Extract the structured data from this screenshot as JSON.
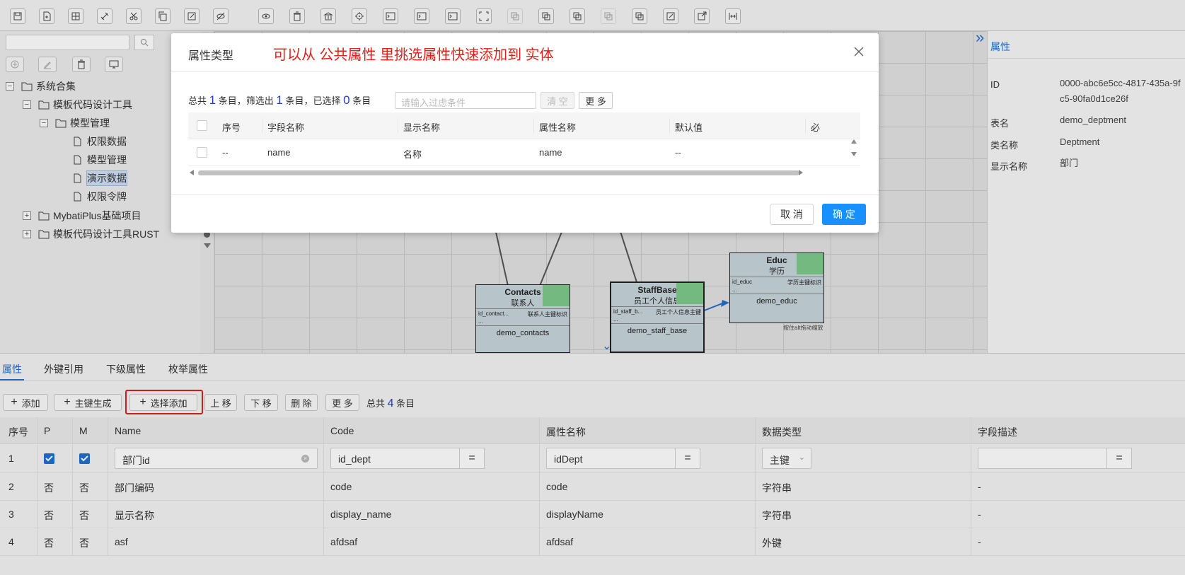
{
  "toolbar": {
    "icons": [
      "save-icon",
      "new-file-icon",
      "grid-icon",
      "link-icon",
      "scissors-icon",
      "copy-icon",
      "edit-icon",
      "hide-icon",
      "eye-icon",
      "trash-icon",
      "bank-icon",
      "target-icon",
      "terminal-icon",
      "terminal-icon",
      "terminal-icon",
      "select-icon",
      "group-icon",
      "group-icon",
      "group-icon",
      "group-icon",
      "group-icon",
      "edit-icon",
      "export-icon",
      "distribute-icon"
    ]
  },
  "tree": {
    "root": "系统合集",
    "items": [
      {
        "label": "模板代码设计工具",
        "level": 1,
        "expanded": true
      },
      {
        "label": "模型管理",
        "level": 2,
        "expanded": true
      },
      {
        "label": "权限数据",
        "level": 3,
        "file": true
      },
      {
        "label": "模型管理",
        "level": 3,
        "file": true
      },
      {
        "label": "演示数据",
        "level": 3,
        "file": true,
        "selected": true
      },
      {
        "label": "权限令牌",
        "level": 3,
        "file": true
      },
      {
        "label": "MybatiPlus基础项目",
        "level": 1,
        "expanded": false
      },
      {
        "label": "模板代码设计工具RUST",
        "level": 1,
        "expanded": false
      }
    ]
  },
  "canvas": {
    "entities": [
      {
        "title": "Contacts",
        "sub": "联系人",
        "attr_left": "id_contact...",
        "attr_right": "联系人主键标识",
        "dots": "...",
        "table": "demo_contacts"
      },
      {
        "title": "StaffBase",
        "sub": "员工个人信息",
        "attr_left": "id_staff_b...",
        "attr_right": "员工个人信息主键",
        "dots": "...",
        "table": "demo_staff_base"
      },
      {
        "title": "Educ",
        "sub": "学历",
        "attr_left": "id_educ",
        "attr_right": "学历主键标识",
        "dots": "...",
        "table": "demo_educ"
      }
    ],
    "hint": "按住alt拖动缩放"
  },
  "right_panel": {
    "title": "属性",
    "rows": [
      {
        "label": "ID",
        "value": "0000-abc6e5cc-4817-435a-9fc5-90fa0d1ce26f"
      },
      {
        "label": "表名",
        "value": "demo_deptment"
      },
      {
        "label": "类名称",
        "value": "Deptment"
      },
      {
        "label": "显示名称",
        "value": "部门"
      }
    ]
  },
  "bottom": {
    "tabs": [
      "属性",
      "外键引用",
      "下级属性",
      "枚举属性"
    ],
    "actions": {
      "add": "添加",
      "pk_gen": "主键生成",
      "select_add": "选择添加",
      "up": "上 移",
      "down": "下 移",
      "delete": "删 除",
      "more": "更 多"
    },
    "count": {
      "prefix": "总共",
      "num": "4",
      "suffix": "条目"
    },
    "headers": [
      "序号",
      "P",
      "M",
      "Name",
      "Code",
      "属性名称",
      "数据类型",
      "字段描述"
    ],
    "rows": [
      {
        "idx": "1",
        "p": "",
        "m": "",
        "name": "部门id",
        "code": "id_dept",
        "prop": "idDept",
        "type": "主键",
        "desc": ""
      },
      {
        "idx": "2",
        "p": "否",
        "m": "否",
        "name": "部门编码",
        "code": "code",
        "prop": "code",
        "type": "字符串",
        "desc": "-"
      },
      {
        "idx": "3",
        "p": "否",
        "m": "否",
        "name": "显示名称",
        "code": "display_name",
        "prop": "displayName",
        "type": "字符串",
        "desc": "-"
      },
      {
        "idx": "4",
        "p": "否",
        "m": "否",
        "name": "asf",
        "code": "afdsaf",
        "prop": "afdsaf",
        "type": "外键",
        "desc": "-"
      }
    ],
    "eq": "="
  },
  "modal": {
    "title": "属性类型",
    "note": "可以从 公共属性 里挑选属性快速添加到 实体",
    "info": {
      "p1": "总共",
      "n1": "1",
      "p2": "条目，筛选出",
      "n2": "1",
      "p3": "条目，已选择",
      "n3": "0",
      "p4": "条目"
    },
    "filter_placeholder": "请输入过虑条件",
    "clear": "清 空",
    "more": "更 多",
    "headers": [
      "序号",
      "字段名称",
      "显示名称",
      "属性名称",
      "默认值",
      "必"
    ],
    "row": {
      "idx": "--",
      "field": "name",
      "display": "名称",
      "prop": "name",
      "default": "--"
    },
    "cancel": "取 消",
    "ok": "确 定"
  },
  "colors": {
    "accent": "#1890ff",
    "link": "#1f6fd1",
    "note": "#e0201a",
    "entity_fill": "#c7d5dc",
    "entity_tag": "#7dc98b"
  }
}
